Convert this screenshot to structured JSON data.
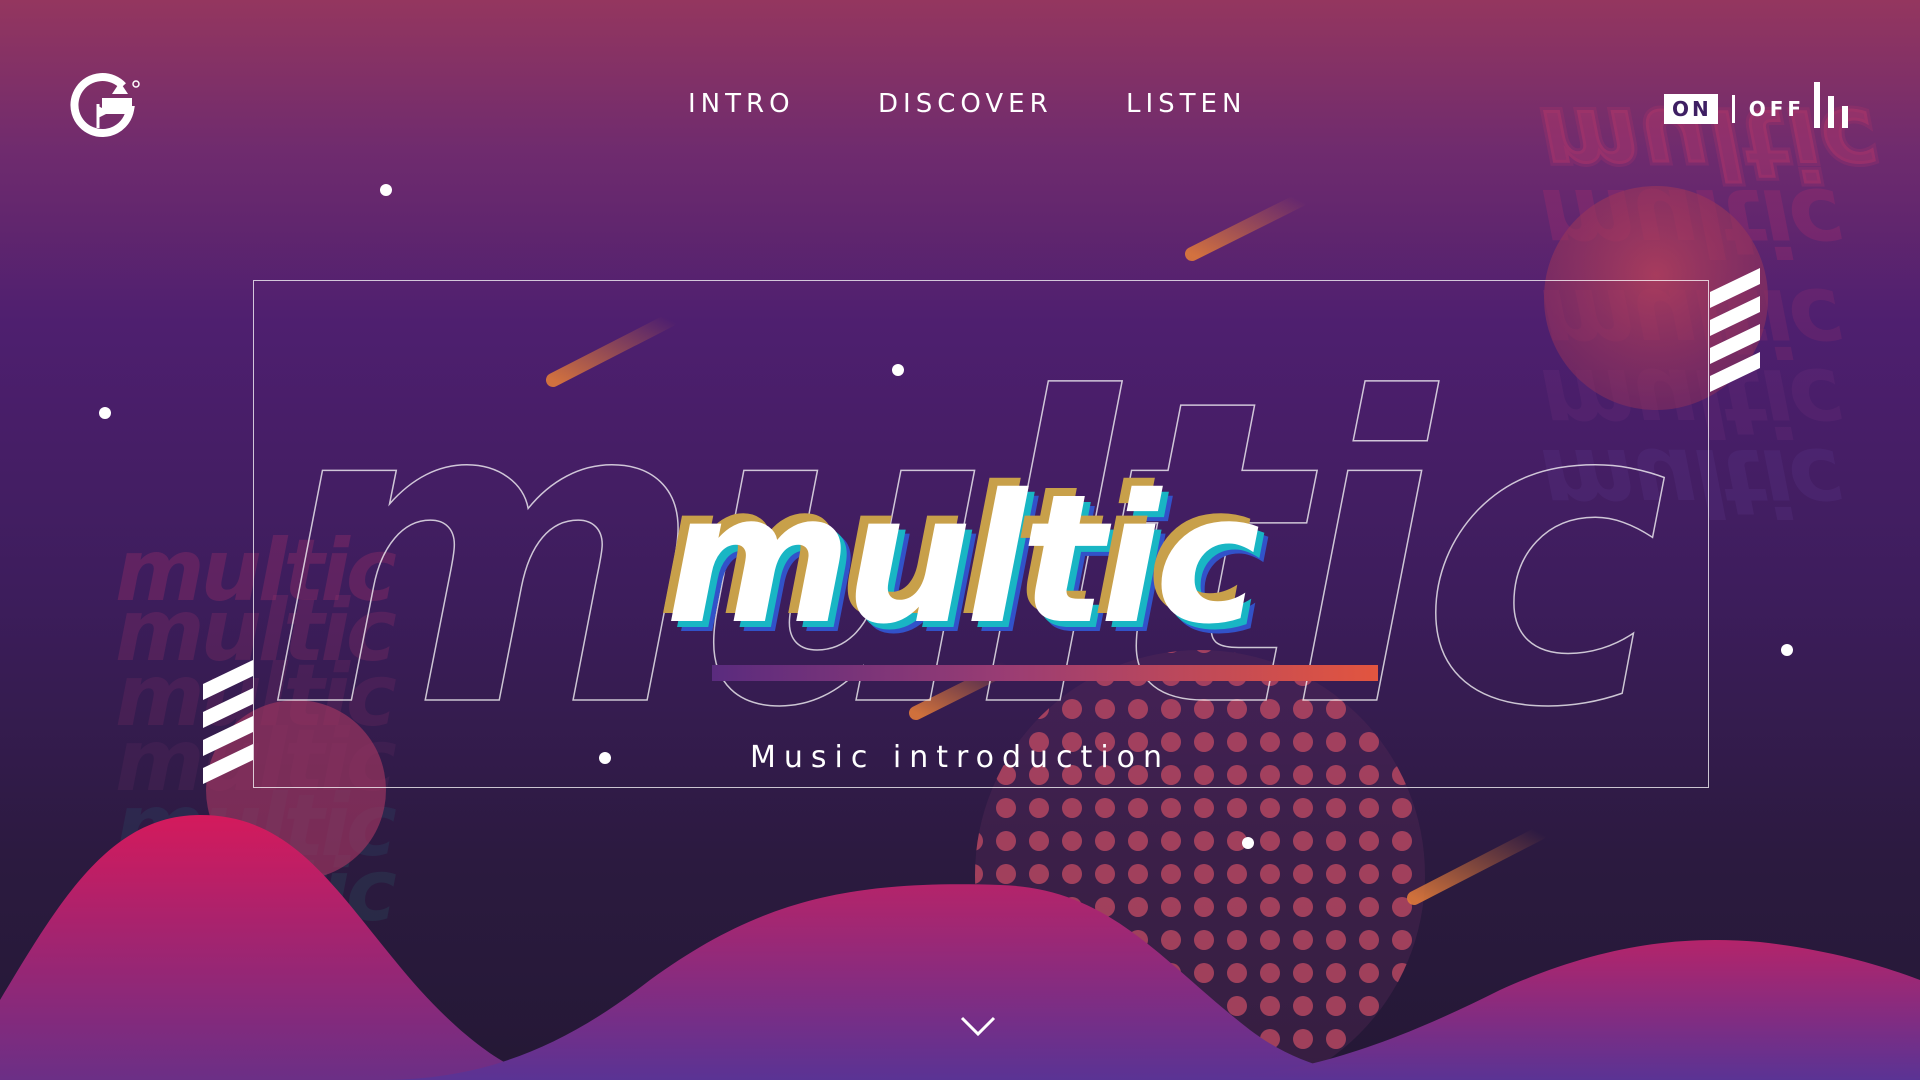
{
  "header": {
    "logo_icon": "g-flag-logo-icon",
    "nav": [
      {
        "label": "INTRO"
      },
      {
        "label": "DISCOVER"
      },
      {
        "label": "LISTEN"
      }
    ],
    "sound_toggle": {
      "on_label": "ON",
      "off_label": "OFF",
      "selected": "ON"
    },
    "equalizer_icon": "equalizer-bars-icon"
  },
  "hero": {
    "title": "multic",
    "outline_title": "multic",
    "subtitle": "Music introduction",
    "scroll_icon": "chevron-down-icon"
  },
  "decor": {
    "watermark_text": "multic",
    "colors": {
      "accent_orange": "#e2553f",
      "accent_pink": "#d81a5f",
      "accent_teal": "#19b6c4",
      "accent_gold": "#c8a04a"
    }
  }
}
